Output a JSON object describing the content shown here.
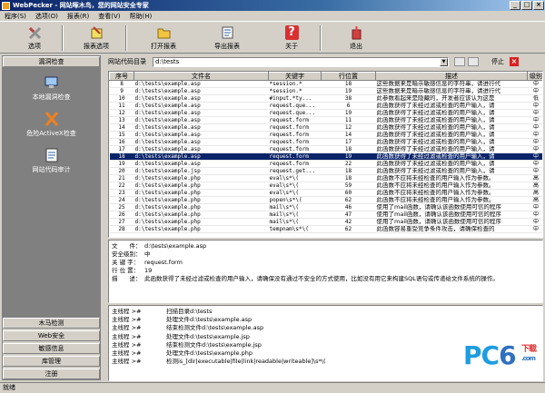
{
  "window": {
    "title": "WebPecker - 网站啄木鸟，您的网站安全专家",
    "buttons": [
      "_",
      "□",
      "×"
    ]
  },
  "menu": [
    "程序(S)",
    "选项(O)",
    "报表(R)",
    "查看(V)",
    "帮助(H)"
  ],
  "toolbar": [
    {
      "label": "选项",
      "icon": "options-icon"
    },
    {
      "label": "报表选项",
      "icon": "report-options-icon"
    },
    {
      "label": "打开报表",
      "icon": "open-report-icon"
    },
    {
      "label": "导出报表",
      "icon": "export-report-icon"
    },
    {
      "label": "关于",
      "icon": "about-icon"
    },
    {
      "label": "退出",
      "icon": "exit-icon"
    }
  ],
  "sidebar": {
    "header": "漏洞检查",
    "items": [
      {
        "label": "本地漏洞检查",
        "icon": "local-scan-icon"
      },
      {
        "label": "危险ActiveX检查",
        "icon": "activex-scan-icon"
      },
      {
        "label": "网站代码审计",
        "icon": "code-audit-icon"
      }
    ],
    "bottom": [
      "木马检测",
      "Web安全",
      "敏感信息",
      "库管理",
      "注册"
    ]
  },
  "dirbar": {
    "label": "网站代码目录",
    "value": "d:\\tests",
    "stop": "停止"
  },
  "grid": {
    "columns": [
      "序号",
      "文件名",
      "关键字",
      "行位置",
      "描述",
      "级别"
    ],
    "rows": [
      {
        "n": "8",
        "file": "d:\\tests\\example.asp",
        "key": "*session.*",
        "line": "18",
        "desc": "这些数据来是暗示敏感信息的字符串，请进行代",
        "lvl": "中"
      },
      {
        "n": "9",
        "file": "d:\\tests\\example.asp",
        "key": "*session.*",
        "line": "19",
        "desc": "这些数据来是暗示敏感信息的字符串，请进行代",
        "lvl": "中"
      },
      {
        "n": "10",
        "file": "d:\\tests\\example.asp",
        "key": "#input.*ty...",
        "line": "38",
        "desc": "此参数看起来是隐藏的，开发者应该认为这是",
        "lvl": "低"
      },
      {
        "n": "11",
        "file": "d:\\tests\\example.asp",
        "key": "request.que...",
        "line": "6",
        "desc": "此函数获得了未经过滤或检查的用户输入，请",
        "lvl": "中"
      },
      {
        "n": "12",
        "file": "d:\\tests\\example.asp",
        "key": "request.que...",
        "line": "19",
        "desc": "此函数获得了未经过滤或检查的用户输入，请",
        "lvl": "中"
      },
      {
        "n": "13",
        "file": "d:\\tests\\example.asp",
        "key": "request.form",
        "line": "11",
        "desc": "此函数获得了未经过滤或检查的用户输入，请",
        "lvl": "中"
      },
      {
        "n": "14",
        "file": "d:\\tests\\example.asp",
        "key": "request.form",
        "line": "12",
        "desc": "此函数获得了未经过滤或检查的用户输入，请",
        "lvl": "中"
      },
      {
        "n": "15",
        "file": "d:\\tests\\example.asp",
        "key": "request.form",
        "line": "14",
        "desc": "此函数获得了未经过滤或检查的用户输入，请",
        "lvl": "中"
      },
      {
        "n": "16",
        "file": "d:\\tests\\example.asp",
        "key": "request.form",
        "line": "17",
        "desc": "此函数获得了未经过滤或检查的用户输入，请",
        "lvl": "中"
      },
      {
        "n": "17",
        "file": "d:\\tests\\example.asp",
        "key": "request.form",
        "line": "18",
        "desc": "此函数获得了未经过滤或检查的用户输入，请",
        "lvl": "中"
      },
      {
        "n": "18",
        "file": "d:\\tests\\example.asp",
        "key": "request.form",
        "line": "19",
        "desc": "此函数获得了未经过滤或检查的用户输入，请",
        "lvl": "中",
        "selected": true
      },
      {
        "n": "19",
        "file": "d:\\tests\\example.asp",
        "key": "request.form",
        "line": "22",
        "desc": "此函数获得了未经过滤或检查的用户输入，请",
        "lvl": "中"
      },
      {
        "n": "20",
        "file": "d:\\tests\\example.jsp",
        "key": "request.get...",
        "line": "18",
        "desc": "此函数获得了未经过滤或检查的用户输入，请",
        "lvl": "中"
      },
      {
        "n": "21",
        "file": "d:\\tests\\example.php",
        "key": "eval\\s*\\(",
        "line": "18",
        "desc": "此函数不应将未经检查的用户输入作为参数。",
        "lvl": "高"
      },
      {
        "n": "22",
        "file": "d:\\tests\\example.php",
        "key": "eval\\s*\\(",
        "line": "59",
        "desc": "此函数不应将未经检查的用户输入作为参数。",
        "lvl": "高"
      },
      {
        "n": "23",
        "file": "d:\\tests\\example.php",
        "key": "eval\\s*\\(",
        "line": "60",
        "desc": "此函数不应将未经检查的用户输入作为参数。",
        "lvl": "高"
      },
      {
        "n": "24",
        "file": "d:\\tests\\example.php",
        "key": "popen\\s*\\(",
        "line": "62",
        "desc": "此函数不应将未经检查的用户输入作为参数。",
        "lvl": "高"
      },
      {
        "n": "25",
        "file": "d:\\tests\\example.php",
        "key": "mail\\s*\\(",
        "line": "46",
        "desc": "使用了mail函数，请确认该函数使用可信的程序",
        "lvl": "中"
      },
      {
        "n": "26",
        "file": "d:\\tests\\example.php",
        "key": "mail\\s*\\(",
        "line": "47",
        "desc": "使用了mail函数，请确认该函数使用可信的程序",
        "lvl": "中"
      },
      {
        "n": "27",
        "file": "d:\\tests\\example.php",
        "key": "mail\\s*\\(",
        "line": "42",
        "desc": "使用了mail函数，请确认该函数使用可信的程序",
        "lvl": "中"
      },
      {
        "n": "28",
        "file": "d:\\tests\\example.php",
        "key": "tempnam\\s*\\(",
        "line": "62",
        "desc": "此函数容易重受竞争条件攻击，请确保检查的",
        "lvl": "中"
      }
    ]
  },
  "detail": [
    {
      "k": "文　　件：",
      "v": "d:\\tests\\example.asp"
    },
    {
      "k": "安全级别：",
      "v": "中"
    },
    {
      "k": "关 键 字：",
      "v": "request.form"
    },
    {
      "k": "行 位 置：",
      "v": "19"
    },
    {
      "k": "描　　述：",
      "v": "此函数获得了未经过滤或检查的用户输入，请确保没有通过不安全的方式使用，比如没有用它来构建SQL语句或传递给文件系统的操作。"
    }
  ],
  "log": [
    {
      "k": "主线程 >#",
      "v": "扫描目录d:\\tests"
    },
    {
      "k": "主线程 >#",
      "v": "处理文件d:\\tests\\example.asp"
    },
    {
      "k": "主线程 >#",
      "v": "结束检测文件d:\\tests\\example.asp"
    },
    {
      "k": "主线程 >#",
      "v": "处理文件d:\\tests\\example.jsp"
    },
    {
      "k": "主线程 >#",
      "v": "结束检测文件d:\\tests\\example.jsp"
    },
    {
      "k": "主线程 >#",
      "v": "处理文件d:\\tests\\example.php"
    },
    {
      "k": "主线程 >#",
      "v": "检测is_[dir|executable|file|link|readable|writeable]\\s*\\("
    }
  ],
  "status": "就绪",
  "watermark": {
    "pc": "PC",
    "six": "6",
    "dl": "下载",
    "com": ".com"
  },
  "colors": {
    "selection": "#0a246a",
    "accent": "#1e9de0"
  }
}
